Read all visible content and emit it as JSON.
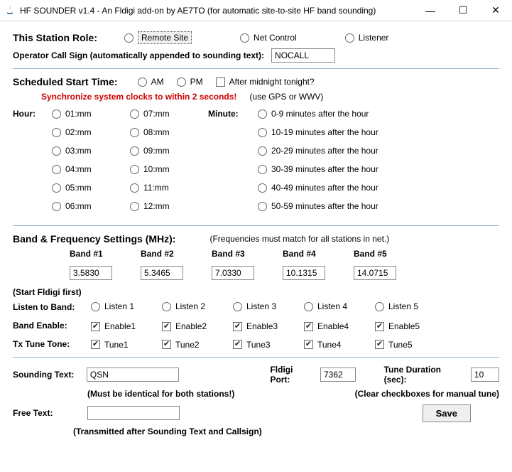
{
  "window": {
    "title": "HF SOUNDER v1.4 - An Fldigi add-on by AE7TO (for automatic site-to-site HF band sounding)"
  },
  "role": {
    "label": "This Station Role:",
    "remote": "Remote Site",
    "net": "Net Control",
    "listener": "Listener"
  },
  "callsign": {
    "label": "Operator Call Sign (automatically appended to sounding text):",
    "value": "NOCALL"
  },
  "schedule": {
    "label": "Scheduled Start Time:",
    "am": "AM",
    "pm": "PM",
    "after_midnight": "After midnight tonight?",
    "sync_msg": "Synchronize system clocks to within 2 seconds!",
    "gps_msg": "(use GPS or WWV)",
    "hour_label": "Hour:",
    "minute_label": "Minute:",
    "hours_a": [
      "01:mm",
      "02:mm",
      "03:mm",
      "04:mm",
      "05:mm",
      "06:mm"
    ],
    "hours_b": [
      "07:mm",
      "08:mm",
      "09:mm",
      "10:mm",
      "11:mm",
      "12:mm"
    ],
    "minutes": [
      "0-9   minutes after the hour",
      "10-19 minutes after the hour",
      "20-29 minutes after the hour",
      "30-39 minutes after the hour",
      "40-49 minutes after the hour",
      "50-59 minutes after the hour"
    ]
  },
  "bands": {
    "label": "Band & Frequency Settings (MHz):",
    "note": "(Frequencies must match for all stations in net.)",
    "headers": [
      "Band #1",
      "Band #2",
      "Band #3",
      "Band #4",
      "Band #5"
    ],
    "values": [
      "3.5830",
      "5.3465",
      "7.0330",
      "10.1315",
      "14.0715"
    ],
    "start_note": "(Start Fldigi first)",
    "listen_label": "Listen to Band:",
    "listen": [
      "Listen 1",
      "Listen 2",
      "Listen 3",
      "Listen 4",
      "Listen 5"
    ],
    "enable_label": "Band Enable:",
    "enable": [
      "Enable1",
      "Enable2",
      "Enable3",
      "Enable4",
      "Enable5"
    ],
    "tune_label": "Tx Tune Tone:",
    "tune": [
      "Tune1",
      "Tune2",
      "Tune3",
      "Tune4",
      "Tune5"
    ]
  },
  "sounding": {
    "label": "Sounding Text:",
    "value": "QSN",
    "note": "(Must be identical for both stations!)",
    "port_label": "Fldigi Port:",
    "port_value": "7362",
    "duration_label": "Tune Duration (sec):",
    "duration_value": "10",
    "clear_note": "(Clear checkboxes for manual tune)"
  },
  "free": {
    "label": "Free Text:",
    "value": "",
    "note": "(Transmitted after Sounding Text and Callsign)"
  },
  "save": "Save"
}
